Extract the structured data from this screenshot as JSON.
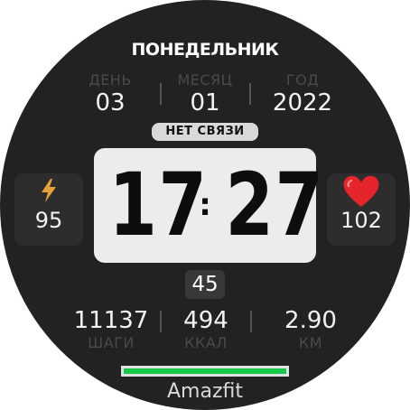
{
  "weekday": "ПОНЕДЕЛЬНИК",
  "date": {
    "day_label": "ДЕНЬ",
    "day_value": "03",
    "month_label": "МЕСЯЦ",
    "month_value": "01",
    "year_label": "ГОД",
    "year_value": "2022"
  },
  "status": "НЕТ СВЯЗИ",
  "time": {
    "hours": "17",
    "separator": ":",
    "minutes": "27",
    "seconds": "45"
  },
  "battery": {
    "icon": "lightning-bolt-icon",
    "value": "95"
  },
  "heart_rate": {
    "icon": "heart-icon",
    "value": "102"
  },
  "stats": {
    "steps_value": "11137",
    "steps_label": "ШАГИ",
    "kcal_value": "494",
    "kcal_label": "ККАЛ",
    "km_value": "2.90",
    "km_label": "КМ"
  },
  "steps_goal_progress": 1.0,
  "brand": "Amazfit",
  "colors": {
    "background": "#222222",
    "accent_bolt": "#e8a23a",
    "heart": "#e5242c",
    "progress": "#16c94a",
    "label": "#4a4a4a"
  }
}
